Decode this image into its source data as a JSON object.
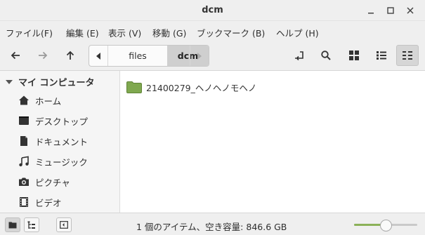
{
  "window": {
    "title": "dcm"
  },
  "menu": [
    "ファイル(F)",
    "編集 (E)",
    "表示 (V)",
    "移動 (G)",
    "ブックマーク (B)",
    "ヘルプ (H)"
  ],
  "pathbar": {
    "crumbs": [
      "files",
      "dcm"
    ],
    "active": "dcm"
  },
  "sidebar": {
    "header": "マイ コンピュータ",
    "items": [
      {
        "label": "ホーム",
        "icon": "home-icon"
      },
      {
        "label": "デスクトップ",
        "icon": "desktop-icon"
      },
      {
        "label": "ドキュメント",
        "icon": "document-icon"
      },
      {
        "label": "ミュージック",
        "icon": "music-icon"
      },
      {
        "label": "ピクチャ",
        "icon": "camera-icon"
      },
      {
        "label": "ビデオ",
        "icon": "film-icon"
      }
    ]
  },
  "files": [
    {
      "name": "21400279_ヘノヘノモヘノ",
      "icon": "folder-icon"
    }
  ],
  "status": {
    "text": "1 個のアイテム、空き容量: 846.6 GB",
    "zoom_fraction": 0.5
  },
  "colors": {
    "folder": "#7fa84f",
    "accent": "#8bb158"
  }
}
